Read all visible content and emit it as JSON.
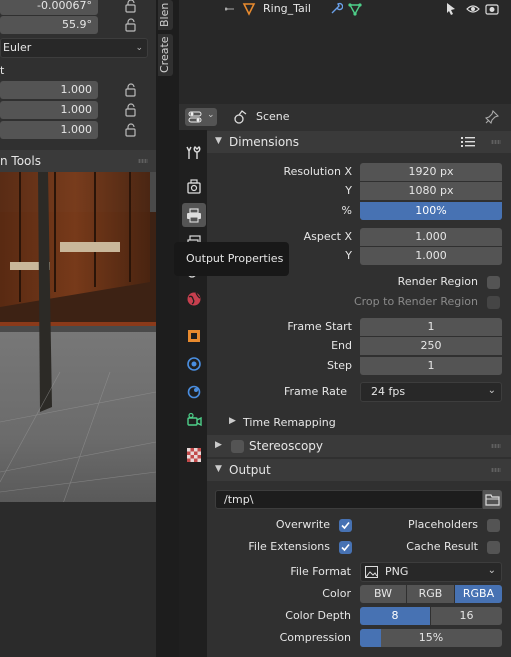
{
  "left_panel": {
    "rotation_y": "-0.00067°",
    "rotation_z": "55.9°",
    "rotation_mode": "Euler",
    "scale_label": "t",
    "scale_x": "1.000",
    "scale_y": "1.000",
    "scale_z": "1.000",
    "tools_header": "n Tools"
  },
  "side_tabs": {
    "blender_tab": "Blen",
    "create_tab": "Create"
  },
  "outliner": {
    "item_name": "Ring_Tail"
  },
  "properties": {
    "scene_label": "Scene",
    "tooltip": "Output Properties",
    "dimensions": {
      "title": "Dimensions",
      "resolution_x_label": "Resolution X",
      "resolution_x": "1920 px",
      "resolution_y_label": "Y",
      "resolution_y": "1080 px",
      "percent_label": "%",
      "percent": "100%",
      "percent_value": 100,
      "aspect_x_label": "Aspect X",
      "aspect_x": "1.000",
      "aspect_y_label": "Y",
      "aspect_y": "1.000",
      "render_region_label": "Render Region",
      "crop_label": "Crop to Render Region",
      "frame_start_label": "Frame Start",
      "frame_start": "1",
      "end_label": "End",
      "end": "250",
      "step_label": "Step",
      "step": "1",
      "frame_rate_label": "Frame Rate",
      "frame_rate": "24 fps",
      "time_remapping": "Time Remapping"
    },
    "stereoscopy": {
      "title": "Stereoscopy"
    },
    "output": {
      "title": "Output",
      "path": "/tmp\\",
      "overwrite_label": "Overwrite",
      "overwrite": true,
      "placeholders_label": "Placeholders",
      "placeholders": false,
      "file_extensions_label": "File Extensions",
      "file_extensions": true,
      "cache_result_label": "Cache Result",
      "cache_result": false,
      "file_format_label": "File Format",
      "file_format": "PNG",
      "color_label": "Color",
      "color_options": [
        "BW",
        "RGB",
        "RGBA"
      ],
      "color_selected": "RGBA",
      "color_depth_label": "Color Depth",
      "color_depth_options": [
        "8",
        "16"
      ],
      "color_depth_selected": "8",
      "compression_label": "Compression",
      "compression": "15%",
      "compression_value": 15
    }
  },
  "colors": {
    "accent": "#4772b3",
    "panel": "#303030",
    "field": "#545454",
    "section": "#3a3a3a"
  }
}
